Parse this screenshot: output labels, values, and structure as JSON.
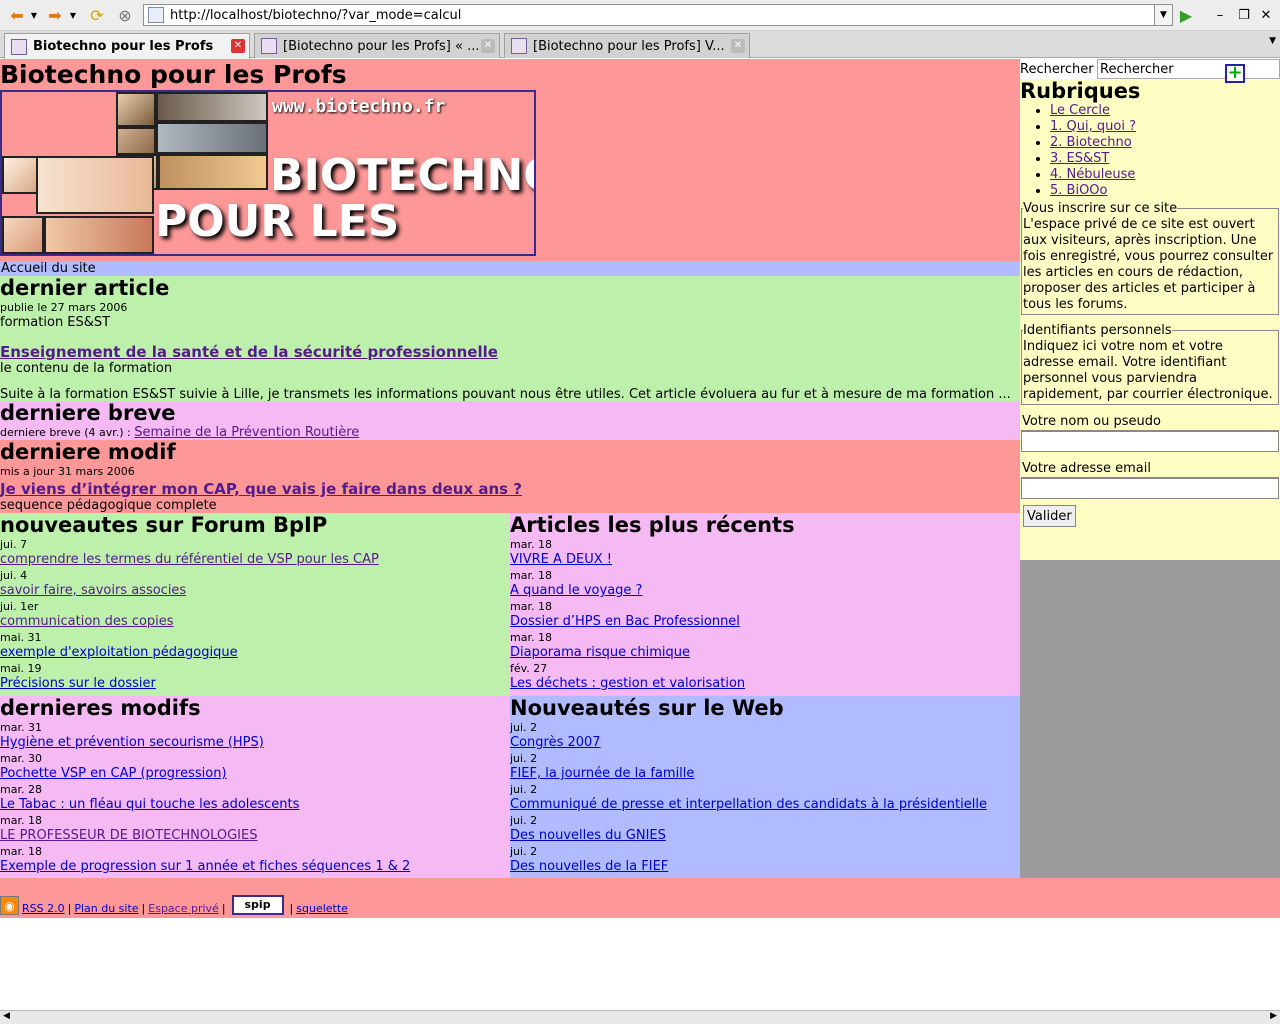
{
  "browser": {
    "url": "http://localhost/biotechno/?var_mode=calcul",
    "tabs": [
      {
        "label": "Biotechno pour les Profs"
      },
      {
        "label": "[Biotechno pour les Profs] « ..."
      },
      {
        "label": "[Biotechno pour les Profs] V..."
      }
    ]
  },
  "site": {
    "name": "Biotechno pour les Profs",
    "banner_url": "www.biotechno.fr",
    "banner_line1": "BIOTECHNO",
    "banner_line2": "POUR LES PROFS",
    "crumb": "Accueil du site"
  },
  "last_article": {
    "heading": "dernier article",
    "date": "publie le 27 mars 2006",
    "rubrique": "formation ES&ST",
    "title": "Enseignement de la santé et de la sécurité professionnelle",
    "subtitle": "le contenu de la formation",
    "intro": "Suite à la formation ES&ST suivie à Lille, je transmets les informations pouvant nous être utiles. Cet article évoluera au fur et à mesure de ma formation ..."
  },
  "last_breve": {
    "heading": "derniere breve",
    "prefix": "derniere breve (4 avr.) : ",
    "link": "Semaine de la Prévention Routière"
  },
  "last_modif": {
    "heading": "derniere modif",
    "date": "mis a jour 31 mars 2006",
    "title": "Je viens d’intégrer mon CAP, que vais je faire dans deux ans ?",
    "desc": "sequence pédagogique complete"
  },
  "forum": {
    "heading": "nouveautes sur Forum BpIP",
    "items": [
      {
        "date": "jui. 7",
        "title": "comprendre les termes du référentiel de VSP pour les CAP"
      },
      {
        "date": "jui. 4",
        "title": "savoir faire, savoirs associes"
      },
      {
        "date": "jui. 1er",
        "title": "communication des copies"
      },
      {
        "date": "mai. 31",
        "title": "exemple d'exploitation pédagogique"
      },
      {
        "date": "mai. 19",
        "title": "Précisions sur le dossier"
      }
    ]
  },
  "recent": {
    "heading": "Articles les plus récents",
    "items": [
      {
        "date": "mar. 18",
        "title": "VIVRE A DEUX !"
      },
      {
        "date": "mar. 18",
        "title": "A quand le voyage ?"
      },
      {
        "date": "mar. 18",
        "title": "Dossier d’HPS en Bac Professionnel"
      },
      {
        "date": "mar. 18",
        "title": "Diaporama risque chimique"
      },
      {
        "date": "fév. 27",
        "title": "Les déchets : gestion et valorisation"
      }
    ]
  },
  "modifs": {
    "heading": "dernieres modifs",
    "items": [
      {
        "date": "mar. 31",
        "title": "Hygiène et prévention secourisme (HPS)"
      },
      {
        "date": "mar. 30",
        "title": "Pochette VSP en CAP (progression)"
      },
      {
        "date": "mar. 28",
        "title": "Le Tabac : un fléau qui touche les adolescents"
      },
      {
        "date": "mar. 18",
        "title": "LE PROFESSEUR DE BIOTECHNOLOGIES"
      },
      {
        "date": "mar. 18",
        "title": "Exemple de progression sur 1 année et fiches séquences 1 & 2"
      }
    ]
  },
  "web": {
    "heading": "Nouveautés sur le Web",
    "items": [
      {
        "date": "jui. 2",
        "title": "Congrès 2007"
      },
      {
        "date": "jui. 2",
        "title": "FIEF, la journée de la famille"
      },
      {
        "date": "jui. 2",
        "title": "Communiqué de presse et interpellation des candidats à la présidentielle"
      },
      {
        "date": "jui. 2",
        "title": "Des nouvelles du GNIES"
      },
      {
        "date": "jui. 2",
        "title": "Des nouvelles de la FIEF"
      }
    ]
  },
  "sidebar": {
    "search_label": "Rechercher",
    "search_value": "Rechercher",
    "rubriques_heading": "Rubriques",
    "rubriques": [
      "Le Cercle",
      "1. Qui, quoi ?",
      "2. Biotechno",
      "3. ES&ST",
      "4. Nébuleuse",
      "5. BiOOo"
    ],
    "inscrire_legend": "Vous inscrire sur ce site",
    "inscrire_text": "L'espace privé de ce site est ouvert aux visiteurs, après inscription. Une fois enregistré, vous pourrez consulter les articles en cours de rédaction, proposer des articles et participer à tous les forums.",
    "ident_legend": "Identifiants personnels",
    "ident_text": "Indiquez ici votre nom et votre adresse email. Votre identifiant personnel vous parviendra rapidement, par courrier électronique.",
    "name_label": "Votre nom ou pseudo",
    "email_label": "Votre adresse email",
    "submit": "Valider"
  },
  "footer": {
    "rss": "RSS 2.0",
    "plan": "Plan du site",
    "prive": "Espace privé",
    "spip": "spip",
    "squelette": "squelette",
    "sep": "|"
  },
  "colors": {
    "pink": "#fe9898",
    "green": "#bdf1ab",
    "violet": "#f5b9f4",
    "blue": "#b0bcff",
    "yellow": "#fefec4"
  }
}
